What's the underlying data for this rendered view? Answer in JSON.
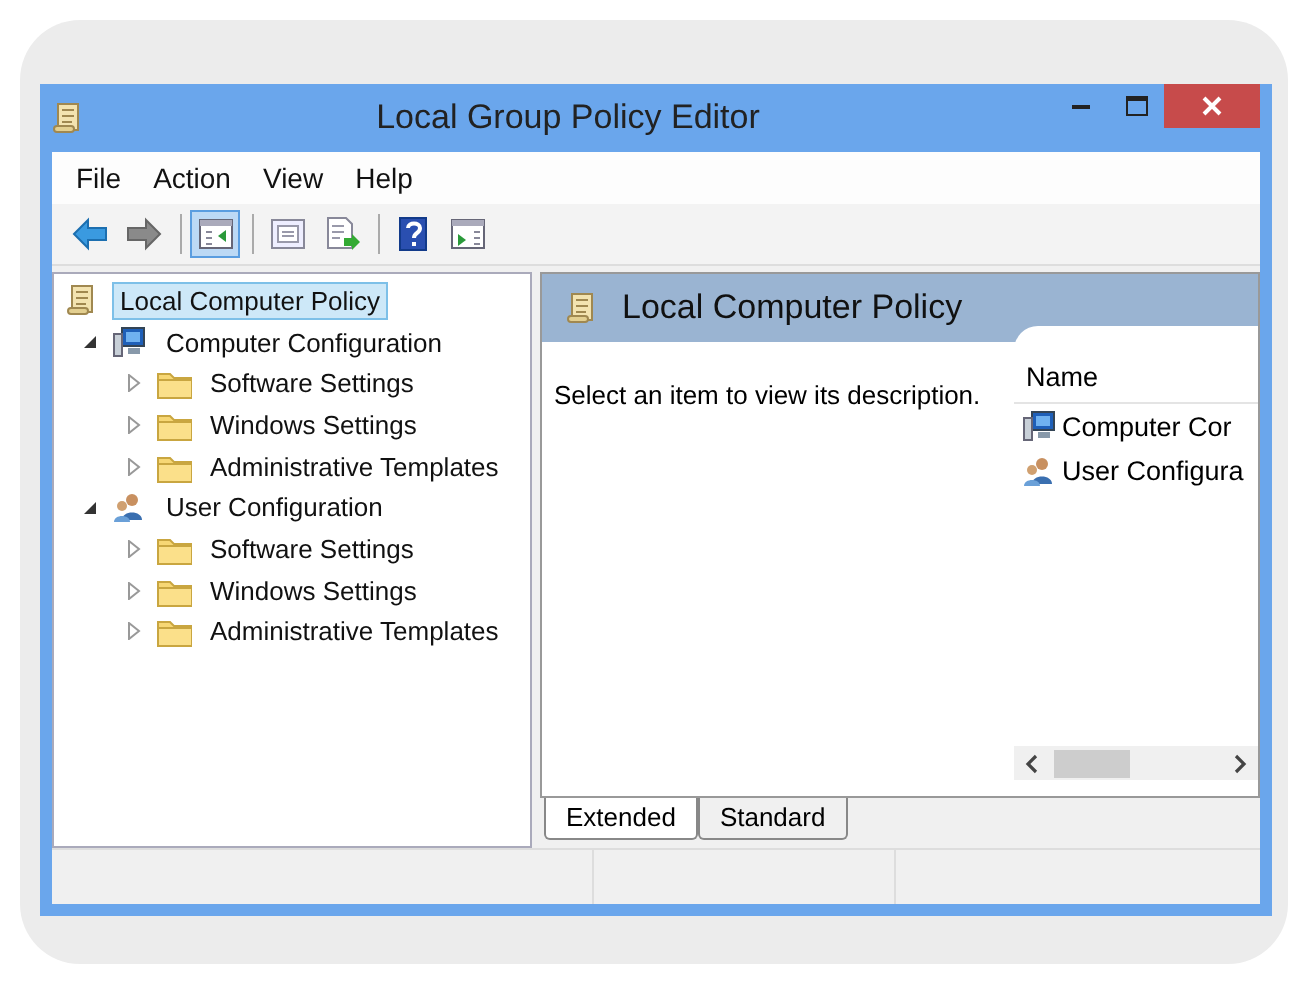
{
  "window": {
    "title": "Local Group Policy Editor"
  },
  "menu": [
    "File",
    "Action",
    "View",
    "Help"
  ],
  "toolbar": [
    [
      {
        "kind": "back",
        "pressed": false
      },
      {
        "kind": "forward",
        "pressed": false
      }
    ],
    [
      {
        "kind": "tree",
        "pressed": true
      }
    ],
    [
      {
        "kind": "properties",
        "pressed": false
      },
      {
        "kind": "export",
        "pressed": false
      }
    ],
    [
      {
        "kind": "help",
        "pressed": false
      },
      {
        "kind": "panel",
        "pressed": false
      }
    ]
  ],
  "tree": [
    {
      "label": "Local Computer Policy",
      "kind": "policy",
      "selected": true,
      "children": [
        {
          "label": "Computer Configuration",
          "kind": "computer",
          "selected": false,
          "expanded": true,
          "children": [
            {
              "label": "Software Settings",
              "kind": "folder",
              "selected": false,
              "expanded": false
            },
            {
              "label": "Windows Settings",
              "kind": "folder",
              "selected": false,
              "expanded": false
            },
            {
              "label": "Administrative Templates",
              "kind": "folder",
              "selected": false,
              "expanded": false
            }
          ]
        },
        {
          "label": "User Configuration",
          "kind": "user",
          "selected": false,
          "expanded": true,
          "children": [
            {
              "label": "Software Settings",
              "kind": "folder",
              "selected": false,
              "expanded": false
            },
            {
              "label": "Windows Settings",
              "kind": "folder",
              "selected": false,
              "expanded": false
            },
            {
              "label": "Administrative Templates",
              "kind": "folder",
              "selected": false,
              "expanded": false
            }
          ]
        }
      ]
    }
  ],
  "details": {
    "title": "Local Computer Policy",
    "description": "Select an item to view its description.",
    "columns": [
      "Name"
    ],
    "rows": [
      {
        "name": "Computer Cor",
        "kind": "computer"
      },
      {
        "name": "User Configura",
        "kind": "user"
      }
    ]
  },
  "tabs": [
    {
      "label": "Extended",
      "selected": true
    },
    {
      "label": "Standard",
      "selected": false
    }
  ]
}
